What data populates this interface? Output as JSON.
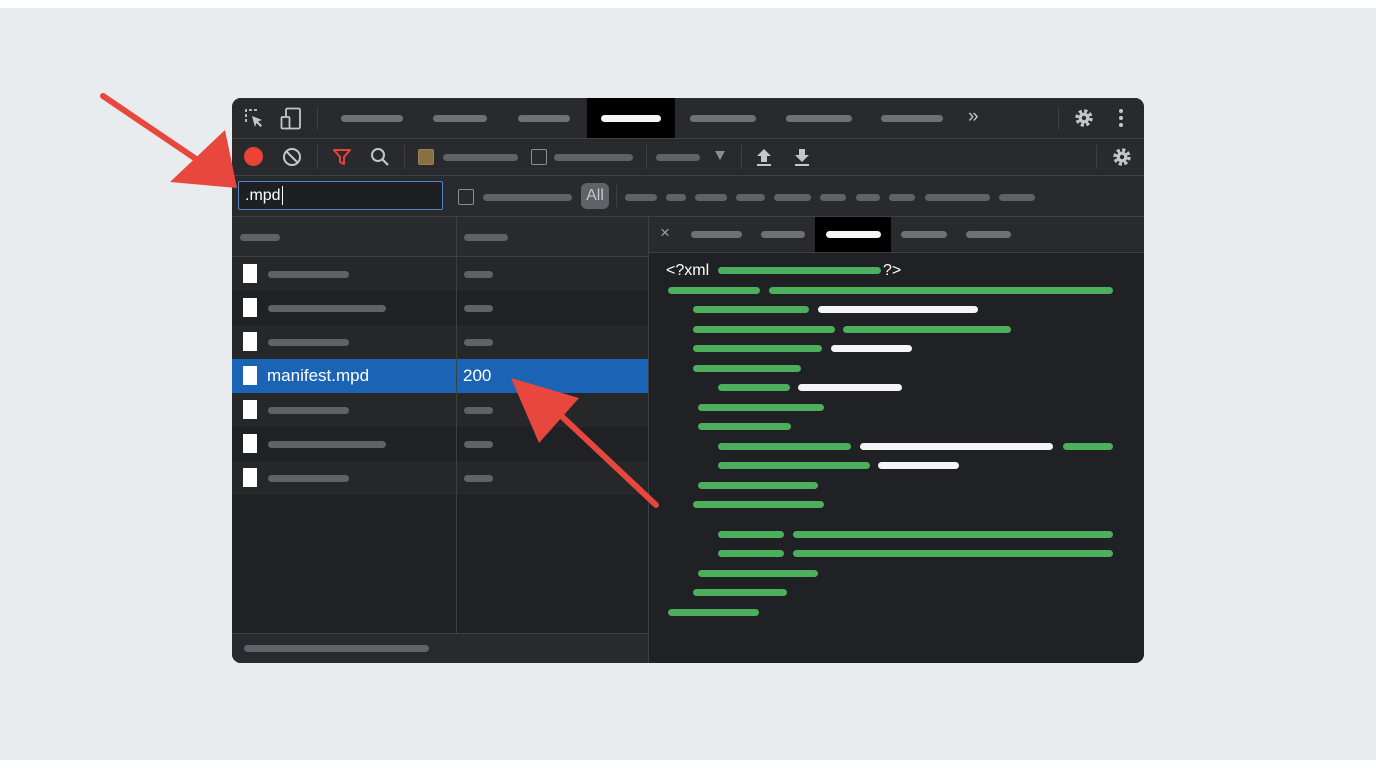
{
  "filter": {
    "value": ".mpd"
  },
  "filter_bar": {
    "all_button": "All"
  },
  "request_list": {
    "selected": {
      "name": "manifest.mpd",
      "status": "200"
    }
  },
  "response": {
    "xml_open": "<?xml",
    "xml_close": "?>"
  },
  "colors": {
    "window_bg": "#202124",
    "selected_row": "#1b64b5",
    "xml_green": "#4caf5c",
    "record_red": "#ea4335",
    "filter_icon_red": "#ea4335",
    "annotation_arrow": "#e8473e"
  },
  "icons": [
    "inspect-element-icon",
    "device-toolbar-icon",
    "more-tabs-icon",
    "settings-icon",
    "more-options-icon",
    "record-icon",
    "clear-icon",
    "filter-icon",
    "search-icon",
    "import-har-icon",
    "export-har-icon",
    "network-settings-icon",
    "close-icon",
    "file-icon"
  ]
}
